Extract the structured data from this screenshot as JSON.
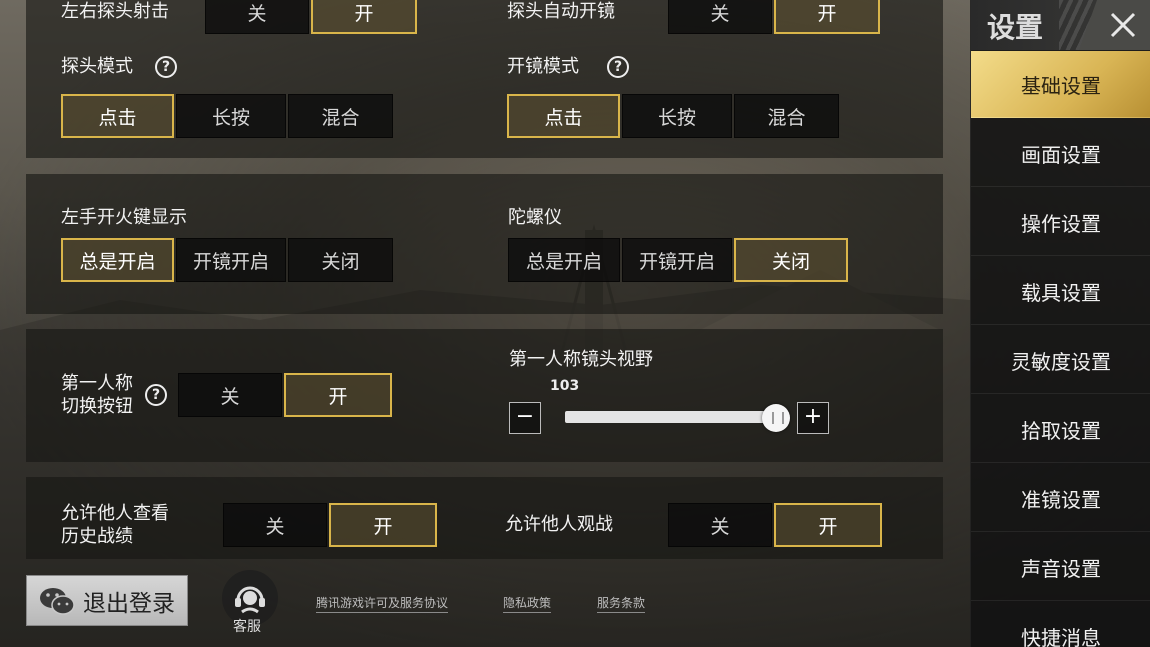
{
  "sidebar": {
    "title": "设置",
    "items": [
      {
        "label": "基础设置",
        "active": true
      },
      {
        "label": "画面设置"
      },
      {
        "label": "操作设置"
      },
      {
        "label": "载具设置"
      },
      {
        "label": "灵敏度设置"
      },
      {
        "label": "拾取设置"
      },
      {
        "label": "准镜设置"
      },
      {
        "label": "声音设置"
      },
      {
        "label": "快捷消息"
      }
    ]
  },
  "settings": {
    "lean_fire": {
      "label": "左右探头射击",
      "options": [
        "关",
        "开"
      ],
      "selected": "开"
    },
    "auto_scope_lean": {
      "label": "探头自动开镜",
      "options": [
        "关",
        "开"
      ],
      "selected": "开"
    },
    "lean_mode": {
      "label": "探头模式",
      "options": [
        "点击",
        "长按",
        "混合"
      ],
      "selected": "点击"
    },
    "scope_mode": {
      "label": "开镜模式",
      "options": [
        "点击",
        "长按",
        "混合"
      ],
      "selected": "点击"
    },
    "left_fire": {
      "label": "左手开火键显示",
      "options": [
        "总是开启",
        "开镜开启",
        "关闭"
      ],
      "selected": "总是开启"
    },
    "gyro": {
      "label": "陀螺仪",
      "options": [
        "总是开启",
        "开镜开启",
        "关闭"
      ],
      "selected": "关闭"
    },
    "fpp_switch": {
      "label_line1": "第一人称",
      "label_line2": "切换按钮",
      "options": [
        "关",
        "开"
      ],
      "selected": "开"
    },
    "fpp_fov": {
      "label": "第一人称镜头视野",
      "value": "103",
      "minus": "−",
      "plus": "+",
      "fraction": 0.95
    },
    "history": {
      "label_line1": "允许他人查看",
      "label_line2": "历史战绩",
      "options": [
        "关",
        "开"
      ],
      "selected": "开"
    },
    "spectate": {
      "label": "允许他人观战",
      "options": [
        "关",
        "开"
      ],
      "selected": "开"
    }
  },
  "footer": {
    "logout": "退出登录",
    "support": "客服",
    "links": [
      "腾讯游戏许可及服务协议",
      "隐私政策",
      "服务条款"
    ]
  },
  "colors": {
    "accent": "#d9b54a",
    "selected_bg": "#5f5232"
  }
}
